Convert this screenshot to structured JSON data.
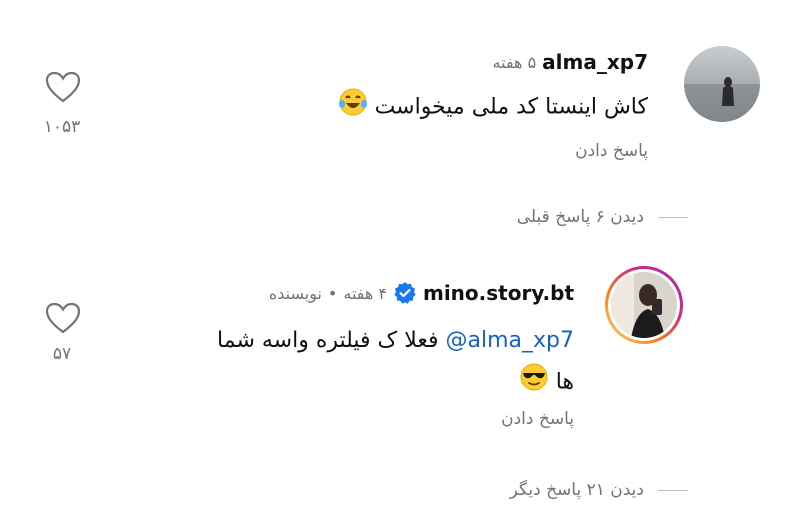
{
  "comment1": {
    "username": "alma_xp7",
    "time": "۵ هفته",
    "text": "کاش اینستا کد ملی میخواست",
    "emoji": "laughing-tears-emoji",
    "reply": "پاسخ دادن",
    "likes": "۱۰۵۳"
  },
  "view_previous": "دیدن ۶ پاسخ قبلی",
  "comment2": {
    "username": "mino.story.bt",
    "time": "۴ هفته",
    "dot": "•",
    "author": "نویسنده",
    "mention": "@alma_xp7",
    "text": "فعلا ک فیلتره واسه شما",
    "text2": "ها",
    "emoji": "sunglasses-emoji",
    "reply": "پاسخ دادن",
    "likes": "۵۷"
  },
  "view_more": "دیدن ۲۱ پاسخ دیگر",
  "colors": {
    "verified": "#1877f2",
    "mention": "#1763c4",
    "muted": "#737373",
    "story_ring": [
      "#feda75",
      "#fa7e1e",
      "#d62976",
      "#962fbf"
    ]
  }
}
